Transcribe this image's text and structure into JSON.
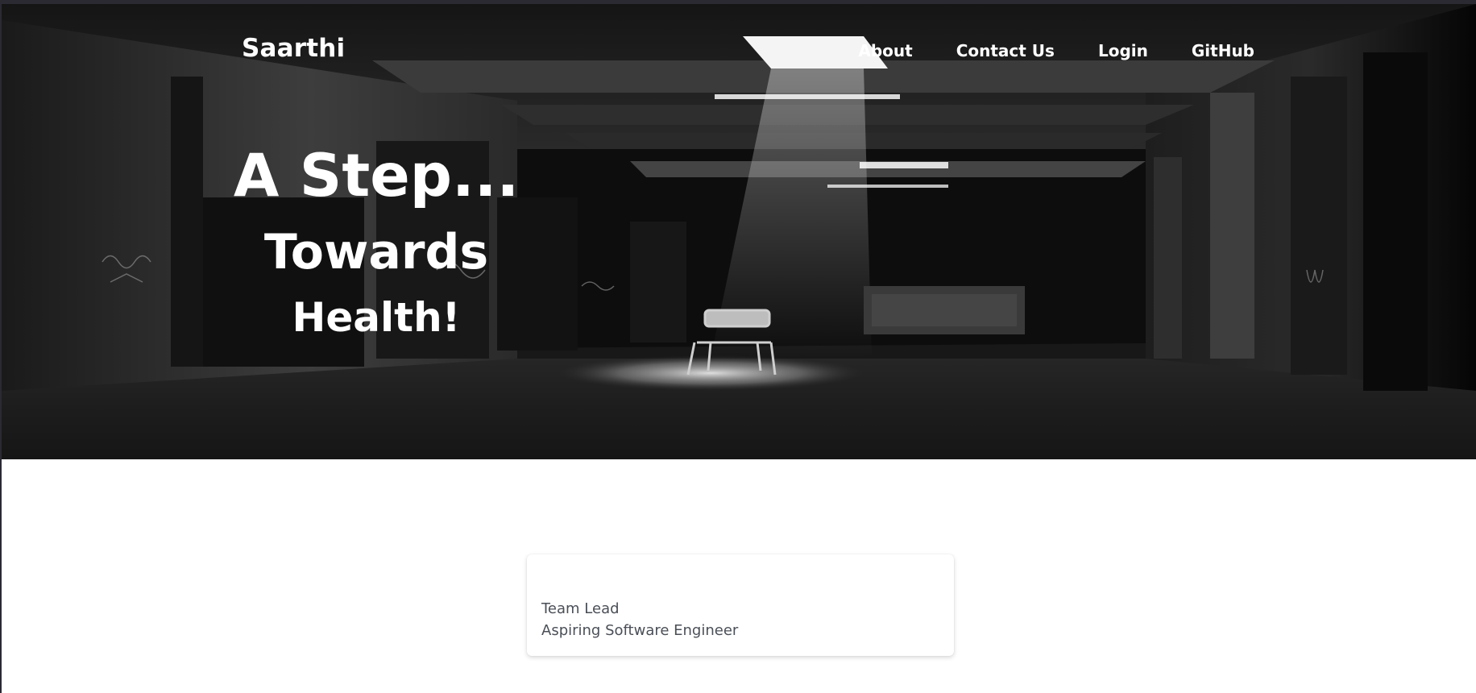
{
  "brand": {
    "name": "Saarthi"
  },
  "nav": {
    "items": [
      {
        "label": "About"
      },
      {
        "label": "Contact Us"
      },
      {
        "label": "Login"
      },
      {
        "label": "GitHub"
      }
    ]
  },
  "hero": {
    "line1": "A Step...",
    "line2": "Towards",
    "line3": "Health!"
  },
  "team_card": {
    "role": "Team Lead",
    "tagline": "Aspiring Software Engineer"
  },
  "colors": {
    "hero_text": "#ffffff",
    "card_text": "#4a4f57",
    "page_bg": "#ffffff"
  }
}
